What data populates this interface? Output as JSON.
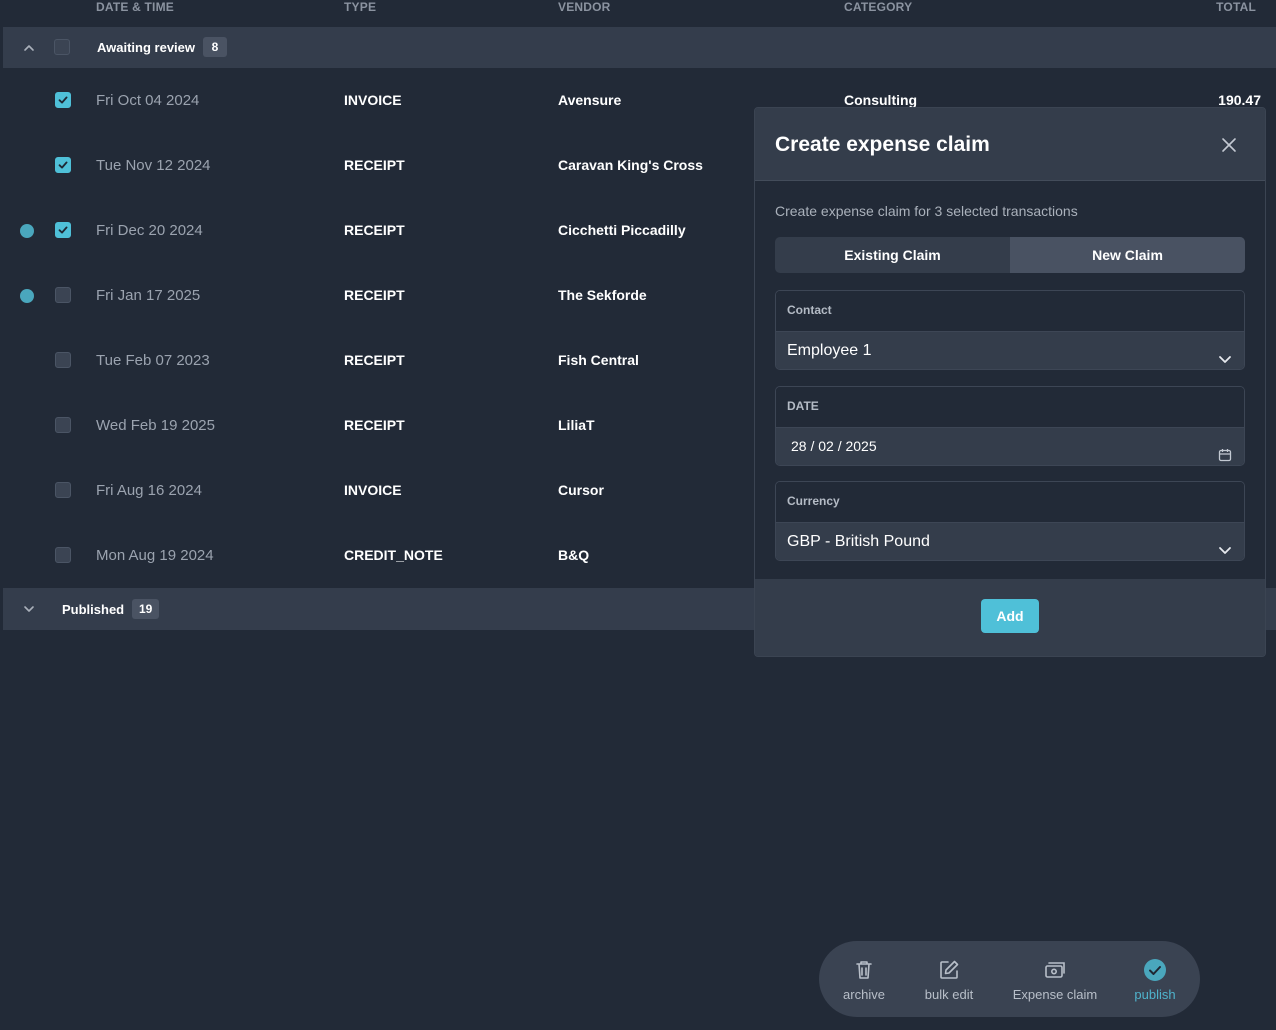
{
  "table": {
    "columns": {
      "date": "DATE & TIME",
      "type": "TYPE",
      "vendor": "VENDOR",
      "category": "CATEGORY",
      "total": "TOTAL"
    },
    "groups": {
      "awaiting": {
        "label": "Awaiting review",
        "count": "8",
        "expanded": true
      },
      "published": {
        "label": "Published",
        "count": "19",
        "expanded": false
      }
    },
    "rows": [
      {
        "date": "Fri Oct 04 2024",
        "type": "INVOICE",
        "vendor": "Avensure",
        "category": "Consulting",
        "total": "190.47",
        "checked": true,
        "dot": false
      },
      {
        "date": "Tue Nov 12 2024",
        "type": "RECEIPT",
        "vendor": "Caravan King's Cross",
        "category": "",
        "total": "",
        "checked": true,
        "dot": false
      },
      {
        "date": "Fri Dec 20 2024",
        "type": "RECEIPT",
        "vendor": "Cicchetti Piccadilly",
        "category": "",
        "total": "",
        "checked": true,
        "dot": true
      },
      {
        "date": "Fri Jan 17 2025",
        "type": "RECEIPT",
        "vendor": "The Sekforde",
        "category": "",
        "total": "",
        "checked": false,
        "dot": true
      },
      {
        "date": "Tue Feb 07 2023",
        "type": "RECEIPT",
        "vendor": "Fish Central",
        "category": "",
        "total": "",
        "checked": false,
        "dot": false
      },
      {
        "date": "Wed Feb 19 2025",
        "type": "RECEIPT",
        "vendor": "LiliaT",
        "category": "",
        "total": "",
        "checked": false,
        "dot": false
      },
      {
        "date": "Fri Aug 16 2024",
        "type": "INVOICE",
        "vendor": "Cursor",
        "category": "",
        "total": "",
        "checked": false,
        "dot": false
      },
      {
        "date": "Mon Aug 19 2024",
        "type": "CREDIT_NOTE",
        "vendor": "B&Q",
        "category": "",
        "total": "",
        "checked": false,
        "dot": false
      }
    ]
  },
  "modal": {
    "title": "Create expense claim",
    "subtitle": "Create expense claim for 3 selected transactions",
    "tabs": {
      "existing": "Existing Claim",
      "new": "New Claim",
      "active": "new"
    },
    "contact": {
      "label": "Contact",
      "value": "Employee 1"
    },
    "date": {
      "label": "DATE",
      "value": "28 / 02 / 2025"
    },
    "currency": {
      "label": "Currency",
      "value": "GBP - British Pound"
    },
    "add_label": "Add"
  },
  "action_bar": {
    "archive": "archive",
    "bulk_edit": "bulk edit",
    "expense_claim": "Expense claim",
    "publish": "publish"
  },
  "colors": {
    "background": "#222a37",
    "accent": "#4fc0d8",
    "group_bar": "#343d4c"
  }
}
